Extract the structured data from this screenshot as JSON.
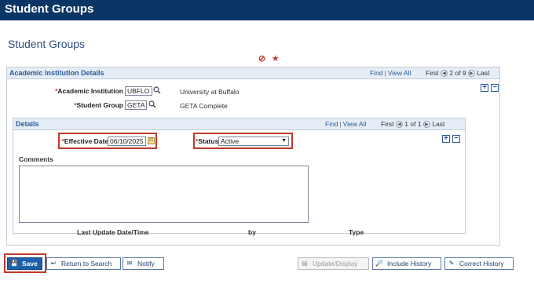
{
  "app": {
    "title": "Student Groups"
  },
  "page": {
    "title": "Student Groups"
  },
  "section": {
    "title": "Academic Institution Details",
    "nav": {
      "find": "Find",
      "view_all": "View All",
      "first": "First",
      "counter": "2 of 9",
      "last": "Last"
    }
  },
  "institution": {
    "label": "Academic Institution",
    "value": "UBFLO",
    "description": "University at Buffalo"
  },
  "group": {
    "label": "Student Group",
    "value": "GETA",
    "description": "GETA Complete"
  },
  "details": {
    "title": "Details",
    "nav": {
      "find": "Find",
      "view_all": "View All",
      "first": "First",
      "counter": "1 of 1",
      "last": "Last"
    },
    "effective_date": {
      "label": "Effective Date",
      "value": "06/10/2025"
    },
    "status": {
      "label": "Status",
      "value": "Active"
    },
    "comments_label": "Comments",
    "comments_value": "",
    "columns": [
      "Last Update Date/Time",
      "by",
      "Type"
    ]
  },
  "required_marker": "*",
  "buttons": {
    "save": "Save",
    "return": "Return to Search",
    "notify": "Notify",
    "update": "Update/Display",
    "include_history": "Include History",
    "correct_history": "Correct History"
  },
  "icons": {
    "noentry": "no-entry-icon",
    "star": "star-icon",
    "lookup": "magnifier-icon",
    "calendar": "calendar-icon"
  },
  "colors": {
    "header": "#0b3565",
    "accent": "#c0392b",
    "link": "#2b5a9a"
  }
}
